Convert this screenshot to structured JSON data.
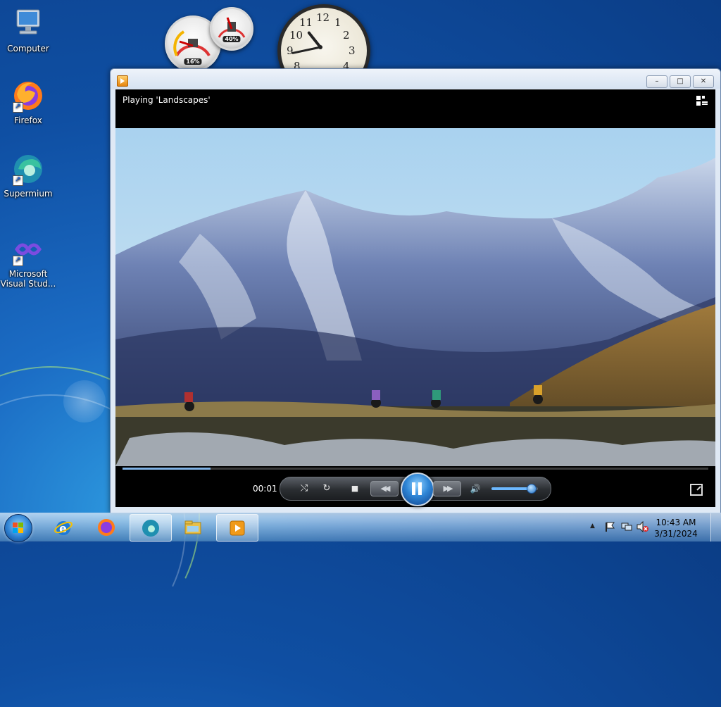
{
  "desktop": {
    "icons": [
      {
        "label": "Computer"
      },
      {
        "label": "Firefox"
      },
      {
        "label": "Supermium"
      },
      {
        "label": "Microsoft Visual Stud..."
      }
    ]
  },
  "gadgets": {
    "cpu_meter": {
      "cpu": "16%",
      "memory": "40%"
    },
    "clock": {
      "numerals": [
        "12",
        "1",
        "2",
        "3",
        "4",
        "8",
        "9",
        "10",
        "11"
      ],
      "hour": 10,
      "minute": 43
    }
  },
  "player": {
    "status": "Playing 'Landscapes'",
    "elapsed": "00:01",
    "progress": 0.15,
    "volume": 0.85,
    "buttons": {
      "shuffle": "⤭",
      "repeat": "↻",
      "stop": "■",
      "previous": "◀◀",
      "next": "▶▶",
      "mute": "🔊"
    }
  },
  "window_buttons": {
    "minimize": "–",
    "maximize": "□",
    "close": "✕"
  },
  "taskbar": {
    "time": "10:43 AM",
    "date": "3/31/2024",
    "items": [
      "internet-explorer",
      "firefox",
      "supermium",
      "windows-explorer",
      "windows-media-player"
    ]
  },
  "colors": {
    "accent": "#2f86d6",
    "desktop": "#0f4fa3"
  }
}
